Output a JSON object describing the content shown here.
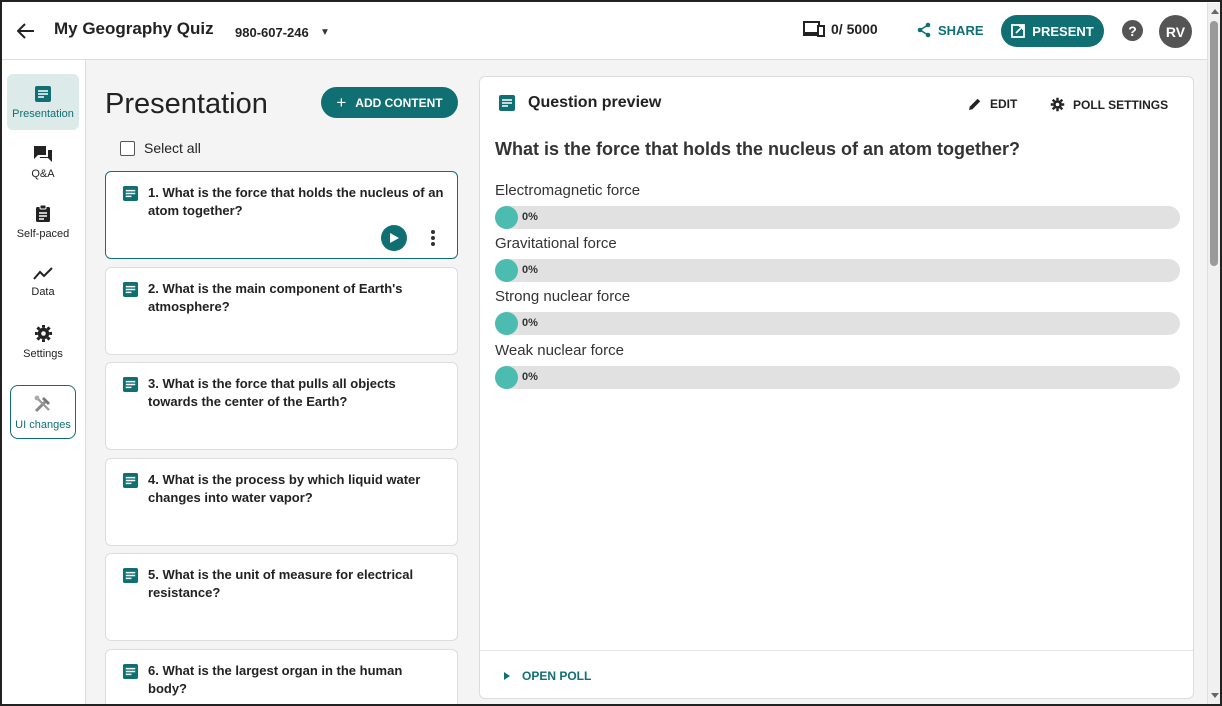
{
  "header": {
    "title": "My Geography Quiz",
    "code": "980-607-246",
    "counter": "0/ 5000",
    "share_label": "SHARE",
    "present_label": "PRESENT",
    "help_label": "?",
    "avatar_initials": "RV"
  },
  "nav": {
    "items": [
      {
        "label": "Presentation"
      },
      {
        "label": "Q&A"
      },
      {
        "label": "Self-paced"
      },
      {
        "label": "Data"
      },
      {
        "label": "Settings"
      },
      {
        "label": "UI changes"
      }
    ]
  },
  "list": {
    "title": "Presentation",
    "add_label": "ADD CONTENT",
    "select_all_label": "Select all",
    "questions": [
      {
        "text": "1. What is the force that holds the nucleus of an atom together?"
      },
      {
        "text": "2. What is the main component of Earth's atmosphere?"
      },
      {
        "text": "3. What is the force that pulls all objects towards the center of the Earth?"
      },
      {
        "text": "4. What is the process by which liquid water changes into water vapor?"
      },
      {
        "text": "5. What is the unit of measure for electrical resistance?"
      },
      {
        "text": "6. What is the largest organ in the human body?"
      }
    ]
  },
  "preview": {
    "heading": "Question preview",
    "edit_label": "EDIT",
    "poll_settings_label": "POLL SETTINGS",
    "question": "What is the force that holds the nucleus of an atom together?",
    "options": [
      {
        "label": "Electromagnetic force",
        "percent": "0%"
      },
      {
        "label": "Gravitational force",
        "percent": "0%"
      },
      {
        "label": "Strong nuclear force",
        "percent": "0%"
      },
      {
        "label": "Weak nuclear force",
        "percent": "0%"
      }
    ],
    "open_poll_label": "OPEN POLL"
  },
  "colors": {
    "brand": "#0f6f73",
    "option_dot": "#4cbcb0",
    "bar_track": "#e1e1e1"
  }
}
